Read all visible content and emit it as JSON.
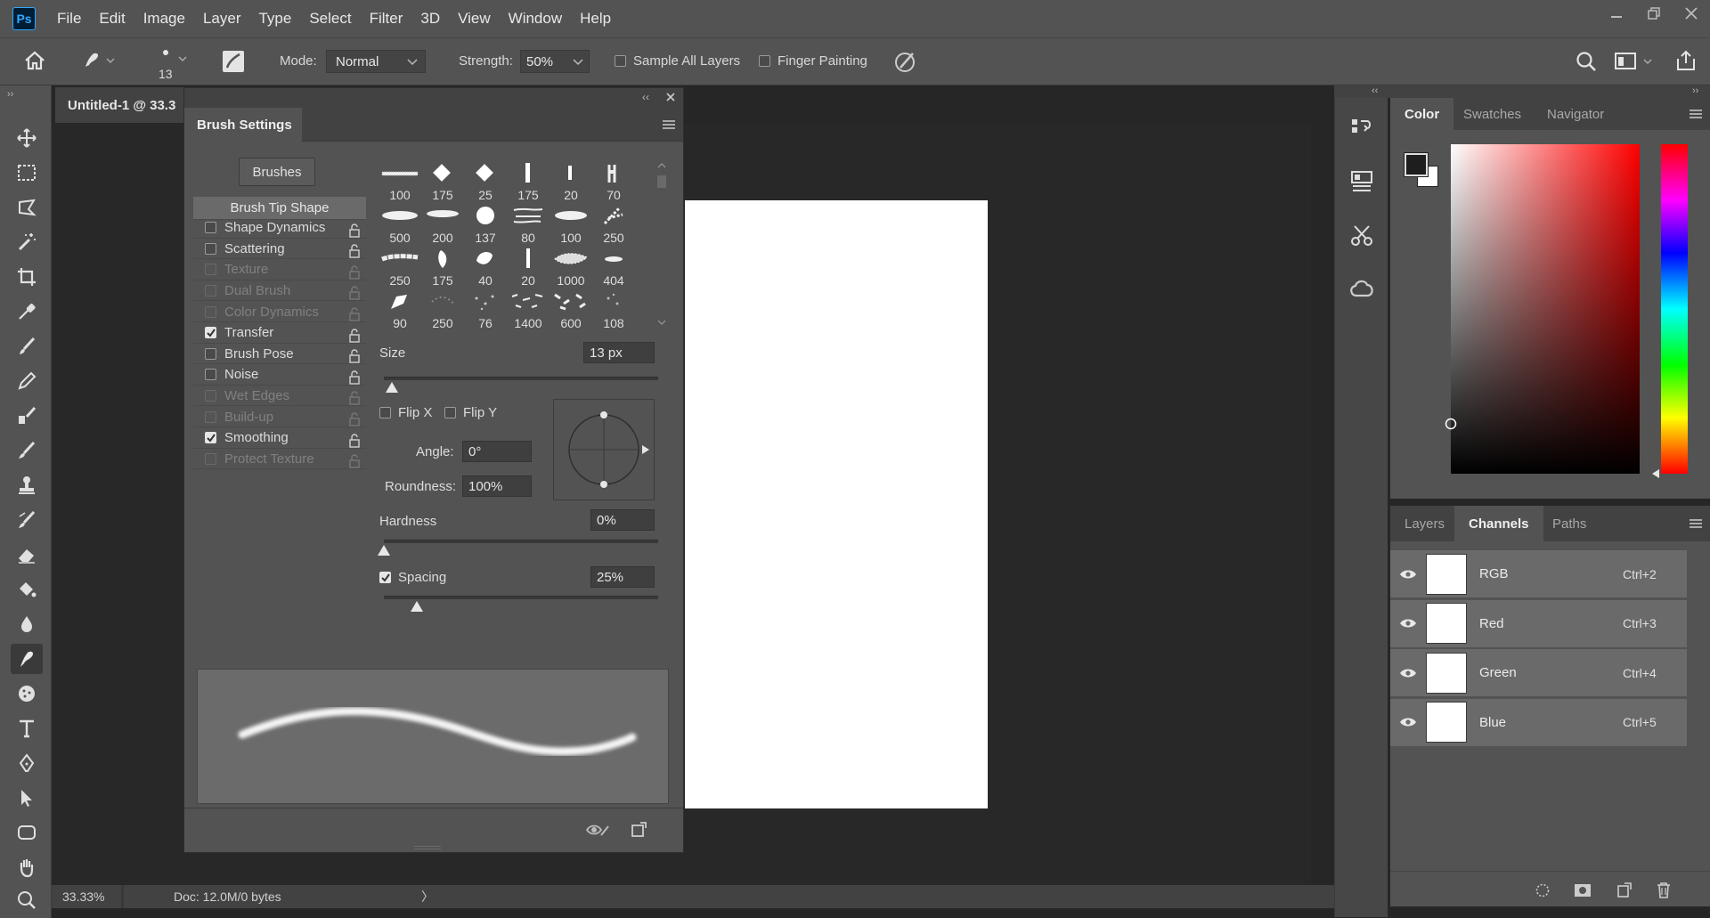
{
  "app": {
    "logo": "Ps"
  },
  "menu": [
    "File",
    "Edit",
    "Image",
    "Layer",
    "Type",
    "Select",
    "Filter",
    "3D",
    "View",
    "Window",
    "Help"
  ],
  "options": {
    "brush_size": "13",
    "mode_label": "Mode:",
    "mode_value": "Normal",
    "strength_label": "Strength:",
    "strength_value": "50%",
    "sample_all_layers": "Sample All Layers",
    "finger_painting": "Finger Painting"
  },
  "document": {
    "tab_title": "Untitled-1 @ 33.3",
    "zoom": "33.33%",
    "doc_info": "Doc: 12.0M/0 bytes",
    "status_arrow": "〉"
  },
  "brush_settings": {
    "title": "Brush Settings",
    "brushes_button": "Brushes",
    "sections": [
      {
        "label": "Brush Tip Shape",
        "checkbox": false,
        "checked": false,
        "dim": false,
        "selected": true
      },
      {
        "label": "Shape Dynamics",
        "checkbox": true,
        "checked": false,
        "dim": false
      },
      {
        "label": "Scattering",
        "checkbox": true,
        "checked": false,
        "dim": false
      },
      {
        "label": "Texture",
        "checkbox": true,
        "checked": false,
        "dim": true
      },
      {
        "label": "Dual Brush",
        "checkbox": true,
        "checked": false,
        "dim": true
      },
      {
        "label": "Color Dynamics",
        "checkbox": true,
        "checked": false,
        "dim": true
      },
      {
        "label": "Transfer",
        "checkbox": true,
        "checked": true,
        "dim": false
      },
      {
        "label": "Brush Pose",
        "checkbox": true,
        "checked": false,
        "dim": false
      },
      {
        "label": "Noise",
        "checkbox": true,
        "checked": false,
        "dim": false
      },
      {
        "label": "Wet Edges",
        "checkbox": true,
        "checked": false,
        "dim": true
      },
      {
        "label": "Build-up",
        "checkbox": true,
        "checked": false,
        "dim": true
      },
      {
        "label": "Smoothing",
        "checkbox": true,
        "checked": true,
        "dim": false
      },
      {
        "label": "Protect Texture",
        "checkbox": true,
        "checked": false,
        "dim": true
      }
    ],
    "brush_tips": [
      "100",
      "175",
      "25",
      "175",
      "20",
      "70",
      "500",
      "200",
      "137",
      "80",
      "100",
      "250",
      "250",
      "175",
      "40",
      "20",
      "1000",
      "404",
      "90",
      "250",
      "76",
      "1400",
      "600",
      "108"
    ],
    "size_label": "Size",
    "size_value": "13 px",
    "size_fraction": 0.03,
    "flip_x": "Flip X",
    "flip_y": "Flip Y",
    "angle_label": "Angle:",
    "angle_value": "0°",
    "roundness_label": "Roundness:",
    "roundness_value": "100%",
    "hardness_label": "Hardness",
    "hardness_value": "0%",
    "hardness_fraction": 0.0,
    "spacing_label": "Spacing",
    "spacing_value": "25%",
    "spacing_fraction": 0.12
  },
  "color_panel": {
    "tabs": [
      "Color",
      "Swatches",
      "Navigator"
    ],
    "foreground": "#1e1e1e",
    "background": "#ffffff"
  },
  "channels_panel": {
    "tabs": [
      "Layers",
      "Channels",
      "Paths"
    ],
    "channels": [
      {
        "name": "RGB",
        "shortcut": "Ctrl+2"
      },
      {
        "name": "Red",
        "shortcut": "Ctrl+3"
      },
      {
        "name": "Green",
        "shortcut": "Ctrl+4"
      },
      {
        "name": "Blue",
        "shortcut": "Ctrl+5"
      }
    ]
  },
  "icons": {
    "toolbar": [
      "move-icon",
      "marquee-icon",
      "lasso-icon",
      "magic-wand-icon",
      "crop-icon",
      "eyedropper-icon",
      "brush-icon",
      "pencil-icon",
      "clone-icon",
      "history-brush-icon",
      "stamp-icon",
      "gradient-icon",
      "eraser-icon",
      "paint-bucket-icon",
      "blur-icon",
      "smudge-icon",
      "sponge-icon",
      "type-icon",
      "pen-icon",
      "path-select-icon",
      "shape-icon",
      "hand-icon",
      "zoom-icon"
    ]
  }
}
